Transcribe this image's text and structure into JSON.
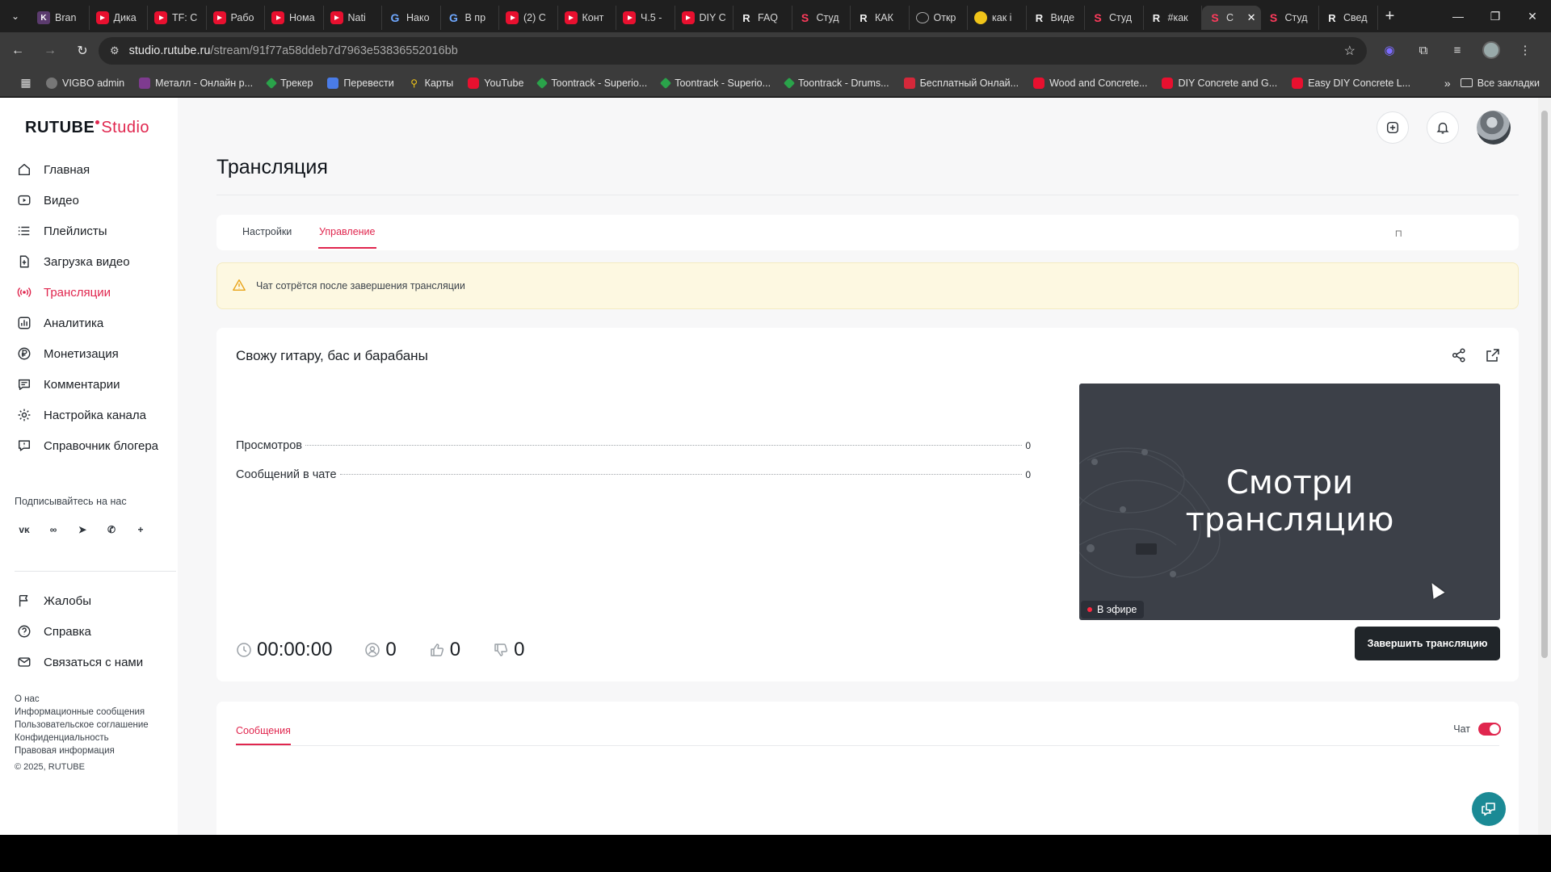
{
  "browser": {
    "tabs": [
      {
        "icon": "k",
        "title": "Bran"
      },
      {
        "icon": "yt",
        "title": "Дика"
      },
      {
        "icon": "yt",
        "title": "TF: С"
      },
      {
        "icon": "yt",
        "title": "Рабо"
      },
      {
        "icon": "yt",
        "title": "Нома"
      },
      {
        "icon": "yt",
        "title": "Nati"
      },
      {
        "icon": "g",
        "title": "Нако"
      },
      {
        "icon": "g",
        "title": "В пр"
      },
      {
        "icon": "yt",
        "title": "(2) С"
      },
      {
        "icon": "yt",
        "title": "Конт"
      },
      {
        "icon": "yt",
        "title": "Ч.5 -"
      },
      {
        "icon": "yt",
        "title": "DIY C"
      },
      {
        "icon": "r",
        "title": "FAQ"
      },
      {
        "icon": "s",
        "title": "Студ"
      },
      {
        "icon": "r",
        "title": "КАК"
      },
      {
        "icon": "o",
        "title": "Откр"
      },
      {
        "icon": "y",
        "title": "как і"
      },
      {
        "icon": "r",
        "title": "Виде"
      },
      {
        "icon": "s",
        "title": "Студ"
      },
      {
        "icon": "r",
        "title": "#как"
      },
      {
        "icon": "s",
        "title": "С",
        "active": true
      },
      {
        "icon": "s",
        "title": "Студ"
      },
      {
        "icon": "r",
        "title": "Свед"
      }
    ],
    "url_host": "studio.rutube.ru",
    "url_path": "/stream/91f77a58ddeb7d7963e53836552016bb",
    "bookmarks": [
      {
        "icon": "gray",
        "label": "VIGBO admin"
      },
      {
        "icon": "purple",
        "label": "Металл - Онлайн р..."
      },
      {
        "icon": "green",
        "label": "Трекер"
      },
      {
        "icon": "blue",
        "label": "Перевести"
      },
      {
        "icon": "map",
        "label": "Карты"
      },
      {
        "icon": "yt",
        "label": "YouTube"
      },
      {
        "icon": "green",
        "label": "Toontrack - Superio..."
      },
      {
        "icon": "green",
        "label": "Toontrack - Superio..."
      },
      {
        "icon": "green",
        "label": "Toontrack - Drums..."
      },
      {
        "icon": "red",
        "label": "Бесплатный Онлай..."
      },
      {
        "icon": "yt",
        "label": "Wood and Concrete..."
      },
      {
        "icon": "yt",
        "label": "DIY Concrete and G..."
      },
      {
        "icon": "yt",
        "label": "Easy DIY Concrete L..."
      }
    ],
    "all_bookmarks": "Все закладки"
  },
  "logo": {
    "main": "RUTUBE",
    "studio": "Studio"
  },
  "sidebar": {
    "items": [
      {
        "label": "Главная",
        "icon": "home-icon"
      },
      {
        "label": "Видео",
        "icon": "video-icon"
      },
      {
        "label": "Плейлисты",
        "icon": "playlist-icon"
      },
      {
        "label": "Загрузка видео",
        "icon": "upload-icon"
      },
      {
        "label": "Трансляции",
        "icon": "broadcast-icon",
        "active": true
      },
      {
        "label": "Аналитика",
        "icon": "analytics-icon"
      },
      {
        "label": "Монетизация",
        "icon": "ruble-icon"
      },
      {
        "label": "Комментарии",
        "icon": "comments-icon"
      },
      {
        "label": "Настройка канала",
        "icon": "gear-icon"
      },
      {
        "label": "Справочник блогера",
        "icon": "help-book-icon"
      }
    ],
    "follow_label": "Подписывайтесь на нас",
    "socials": [
      "VK",
      "OK",
      "TG",
      "VB",
      "+"
    ],
    "secondary": [
      {
        "label": "Жалобы",
        "icon": "flag-icon"
      },
      {
        "label": "Справка",
        "icon": "question-icon"
      },
      {
        "label": "Связаться с нами",
        "icon": "mail-icon"
      }
    ],
    "footer_links": [
      "О нас",
      "Информационные сообщения",
      "Пользовательское соглашение",
      "Конфиденциальность",
      "Правовая информация"
    ],
    "copyright": "© 2025, RUTUBE"
  },
  "page": {
    "title": "Трансляция",
    "tabs": [
      {
        "label": "Настройки"
      },
      {
        "label": "Управление",
        "active": true
      }
    ],
    "warning": "Чат сотрётся после завершения трансляции",
    "stream": {
      "title": "Свожу гитару, бас и барабаны",
      "stats": [
        {
          "label": "Просмотров",
          "value": "0"
        },
        {
          "label": "Сообщений в чате",
          "value": "0"
        }
      ],
      "preview_line1": "Смотри",
      "preview_line2": "трансляцию",
      "live_label": "В эфире",
      "duration": "00:00:00",
      "viewers": "0",
      "likes": "0",
      "dislikes": "0",
      "end_button": "Завершить трансляцию"
    },
    "chat": {
      "tab": "Сообщения",
      "toggle_label": "Чат",
      "enabled": true
    }
  },
  "colors": {
    "accent": "#e0264e",
    "live": "#ff2740",
    "end_button_bg": "#202529",
    "warning_bg": "#fdf8e1",
    "fab": "#1b8a95"
  }
}
